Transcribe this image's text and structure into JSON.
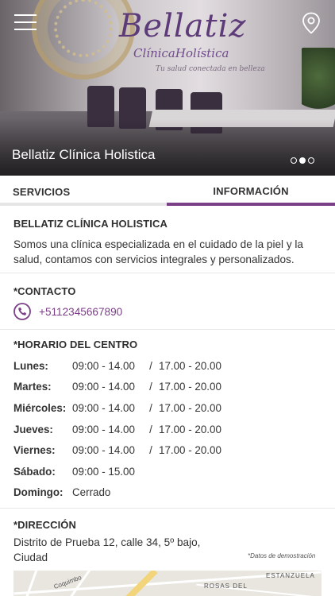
{
  "hero": {
    "title": "Bellatiz Clínica Holistica",
    "brand_name": "Bellatiz",
    "brand_subtitle": "ClínicaHolística",
    "brand_tagline": "Tu salud conectada en belleza",
    "carousel_total": 3,
    "carousel_active": 2
  },
  "tabs": [
    {
      "label": "SERVICIOS",
      "active": false
    },
    {
      "label": "INFORMACIÓN",
      "active": true
    }
  ],
  "about": {
    "title": "BELLATIZ CLÍNICA HOLISTICA",
    "description": "Somos una clínica especializada en el cuidado de la piel y la salud, contamos con servicios integrales y personalizados."
  },
  "contact": {
    "title": "*CONTACTO",
    "phone": "+5112345667890"
  },
  "hours": {
    "title": "*HORARIO DEL CENTRO",
    "rows": [
      {
        "day": "Lunes:",
        "morning": "09:00 - 14.00",
        "sep": "/",
        "afternoon": "17.00 - 20.00"
      },
      {
        "day": "Martes:",
        "morning": "09:00 - 14.00",
        "sep": "/",
        "afternoon": "17.00 - 20.00"
      },
      {
        "day": "Miércoles:",
        "morning": "09:00 - 14.00",
        "sep": "/",
        "afternoon": "17.00 - 20.00"
      },
      {
        "day": "Jueves:",
        "morning": "09:00 - 14.00",
        "sep": "/",
        "afternoon": "17.00 - 20.00"
      },
      {
        "day": "Viernes:",
        "morning": "09:00 - 14.00",
        "sep": "/",
        "afternoon": "17.00 - 20.00"
      },
      {
        "day": "Sábado:",
        "morning": "09:00 - 15.00",
        "sep": "",
        "afternoon": ""
      },
      {
        "day": "Domingo:",
        "morning": "Cerrado",
        "sep": "",
        "afternoon": ""
      }
    ]
  },
  "address": {
    "title": "*DIRECCIÓN",
    "text": "Distrito de Prueba 12, calle 34, 5º bajo, Ciudad",
    "demo_note": "*Datos de demostración",
    "map_labels": [
      "ESTANZUELA",
      "ROSAS DEL",
      "Coquimbo"
    ]
  },
  "colors": {
    "accent": "#7a3f86",
    "tab_inactive_underline": "#e6e6e6"
  },
  "icons": {
    "menu": "hamburger-menu-icon",
    "location": "map-pin-icon",
    "phone": "phone-circle-icon"
  }
}
